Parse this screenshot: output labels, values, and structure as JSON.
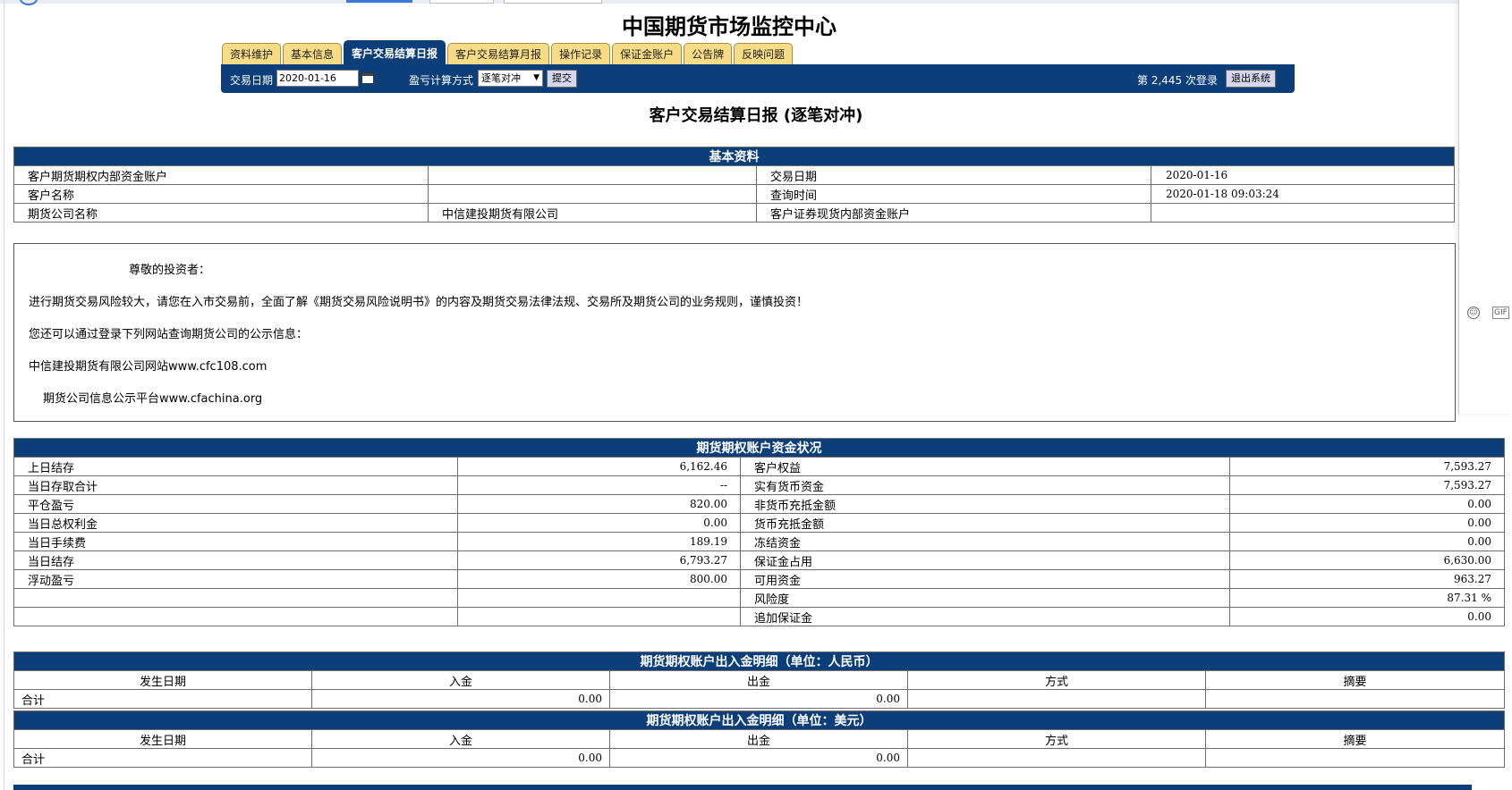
{
  "site": {
    "title": "中国期货市场监控中心"
  },
  "tabs": [
    {
      "label": "资料维护",
      "active": false
    },
    {
      "label": "基本信息",
      "active": false
    },
    {
      "label": "客户交易结算日报",
      "active": true
    },
    {
      "label": "客户交易结算月报",
      "active": false
    },
    {
      "label": "操作记录",
      "active": false
    },
    {
      "label": "保证金账户",
      "active": false
    },
    {
      "label": "公告牌",
      "active": false
    },
    {
      "label": "反映问题",
      "active": false
    }
  ],
  "toolbar": {
    "date_label": "交易日期",
    "date_value": "2020-01-16",
    "calc_label": "盈亏计算方式",
    "calc_value": "逐笔对冲",
    "submit_label": "提交",
    "login_count": "第 2,445 次登录",
    "logout_label": "退出系统"
  },
  "report": {
    "title": "客户交易结算日报 (逐笔对冲)"
  },
  "basic": {
    "header": "基本资料",
    "rows": [
      {
        "l1": "客户期货期权内部资金账户",
        "v1": "",
        "l2": "交易日期",
        "v2": "2020-01-16"
      },
      {
        "l1": "客户名称",
        "v1": "",
        "l2": "查询时间",
        "v2": "2020-01-18 09:03:24"
      },
      {
        "l1": "期货公司名称",
        "v1": "中信建投期货有限公司",
        "l2": "客户证券现货内部资金账户",
        "v2": ""
      }
    ]
  },
  "notice": {
    "greeting": "尊敬的投资者：",
    "line1": "进行期货交易风险较大，请您在入市交易前，全面了解《期货交易风险说明书》的内容及期货交易法律法规、交易所及期货公司的业务规则，谨慎投资！",
    "line2": "您还可以通过登录下列网站查询期货公司的公示信息：",
    "line3": "中信建投期货有限公司网站www.cfc108.com",
    "line4": "期货公司信息公示平台www.cfachina.org"
  },
  "funds": {
    "header": "期货期权账户资金状况",
    "rows": [
      {
        "l1": "上日结存",
        "v1": "6,162.46",
        "l2": "客户权益",
        "v2": "7,593.27"
      },
      {
        "l1": "当日存取合计",
        "v1": "--",
        "l2": "实有货币资金",
        "v2": "7,593.27"
      },
      {
        "l1": "平仓盈亏",
        "v1": "820.00",
        "l2": "非货币充抵金额",
        "v2": "0.00"
      },
      {
        "l1": "当日总权利金",
        "v1": "0.00",
        "l2": "货币充抵金额",
        "v2": "0.00"
      },
      {
        "l1": "当日手续费",
        "v1": "189.19",
        "l2": "冻结资金",
        "v2": "0.00"
      },
      {
        "l1": "当日结存",
        "v1": "6,793.27",
        "l2": "保证金占用",
        "v2": "6,630.00"
      },
      {
        "l1": "浮动盈亏",
        "v1": "800.00",
        "l2": "可用资金",
        "v2": "963.27"
      },
      {
        "l1": "",
        "v1": "",
        "l2": "风险度",
        "v2": "87.31 %"
      },
      {
        "l1": "",
        "v1": "",
        "l2": "追加保证金",
        "v2": "0.00"
      }
    ]
  },
  "cny": {
    "header": "期货期权账户出入金明细（单位：人民币）",
    "columns": [
      "发生日期",
      "入金",
      "出金",
      "方式",
      "摘要"
    ],
    "total_label": "合计",
    "total_in": "0.00",
    "total_out": "0.00"
  },
  "usd": {
    "header": "期货期权账户出入金明细（单位：美元）",
    "columns": [
      "发生日期",
      "入金",
      "出金",
      "方式",
      "摘要"
    ],
    "total_label": "合计",
    "total_in": "0.00",
    "total_out": "0.00"
  },
  "colors": {
    "navy": "#0c3f79",
    "tab": "#f6dc86"
  }
}
